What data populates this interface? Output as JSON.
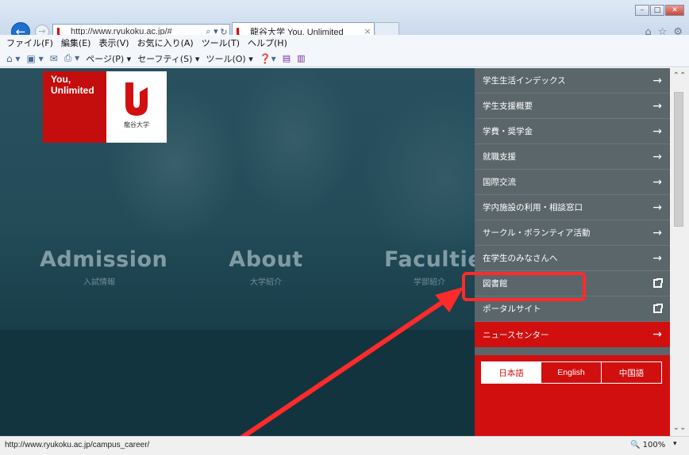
{
  "browser": {
    "address_url": "http://www.ryukoku.ac.jp/#",
    "search_glyph": "⌕ ▾",
    "refresh_glyph": "↻",
    "tab_title": "龍谷大学 You, Unlimited",
    "tab_close": "×",
    "back_glyph": "←",
    "forward_glyph": "→",
    "win_minimize": "–",
    "win_maximize": "□",
    "win_close": "✕",
    "right_icons": [
      "home-icon",
      "star-icon",
      "gear-icon"
    ],
    "right_icon_glyphs": [
      "⌂",
      "☆",
      "⚙"
    ],
    "menu": [
      "ファイル(F)",
      "編集(E)",
      "表示(V)",
      "お気に入り(A)",
      "ツール(T)",
      "ヘルプ(H)"
    ],
    "toolbar": {
      "page": "ページ(P) ▾",
      "safety": "セーフティ(S) ▾",
      "tools": "ツール(O) ▾"
    }
  },
  "site": {
    "brand": {
      "tagline": "You, Unlimited",
      "name_jp": "龍谷大学"
    },
    "hero_links": [
      {
        "en": "Admission",
        "jp": "入試情報"
      },
      {
        "en": "About",
        "jp": "大学紹介"
      },
      {
        "en": "Faculties",
        "jp": "学部紹介"
      }
    ],
    "side_menu": [
      {
        "label": "学生生活インデックス",
        "icon": "arrow-right-icon"
      },
      {
        "label": "学生支援概要",
        "icon": "arrow-right-icon"
      },
      {
        "label": "学費・奨学金",
        "icon": "arrow-right-icon"
      },
      {
        "label": "就職支援",
        "icon": "arrow-right-icon"
      },
      {
        "label": "国際交流",
        "icon": "arrow-right-icon"
      },
      {
        "label": "学内施設の利用・相談窓口",
        "icon": "arrow-right-icon"
      },
      {
        "label": "サークル・ボランティア活動",
        "icon": "arrow-right-icon"
      },
      {
        "label": "在学生のみなさんへ",
        "icon": "arrow-right-icon"
      },
      {
        "label": "図書館",
        "icon": "external-link-icon"
      },
      {
        "label": "ポータルサイト",
        "icon": "external-link-icon"
      }
    ],
    "arrow_glyph": "→",
    "news_center": "ニュースセンター",
    "languages": [
      {
        "label": "日本語",
        "active": true
      },
      {
        "label": "English",
        "active": false
      },
      {
        "label": "中国語",
        "active": false
      }
    ]
  },
  "status": {
    "url": "http://www.ryukoku.ac.jp/campus_career/",
    "zoom": "100%",
    "zoom_drop": "▾"
  },
  "colors": {
    "brand_red": "#c40d0d",
    "menu_bg": "#5b666b",
    "annotation_red": "#ff2a2a",
    "hero_bg": "#1f4754"
  }
}
